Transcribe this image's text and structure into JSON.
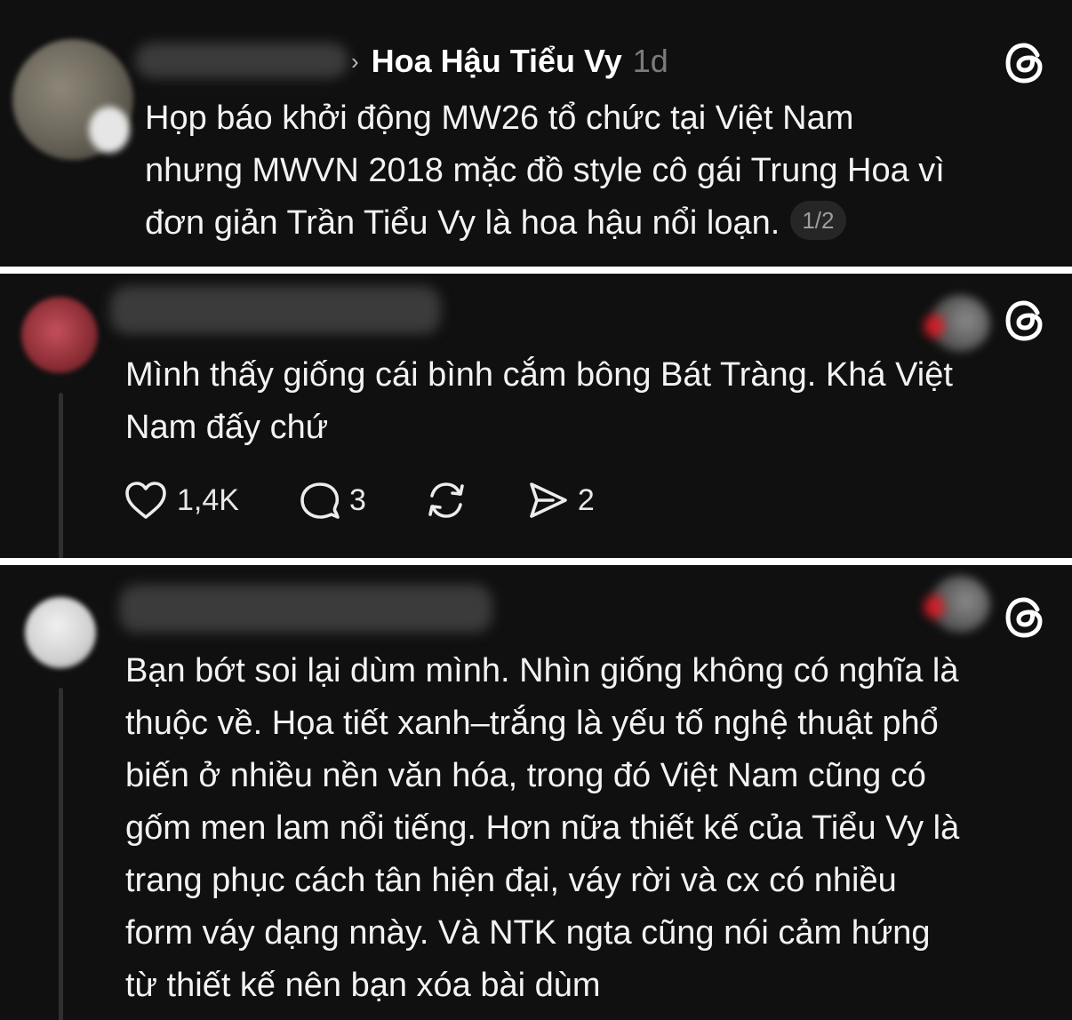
{
  "post": {
    "author": "Hoa Hậu Tiểu Vy",
    "time": "1d",
    "lines": [
      "Họp báo khởi động MW26 tổ chức tại Việt Nam",
      "nhưng MWVN 2018 mặc đồ style cô gái Trung Hoa vì",
      "đơn giản Trần Tiểu Vy là hoa hậu nổi loạn."
    ],
    "page_badge": "1/2"
  },
  "reply_1": {
    "lines": [
      "Mình thấy giống cái bình cắm bông Bát Tràng. Khá Việt",
      "Nam đấy chứ"
    ],
    "likes": "1,4K",
    "comments": "3",
    "shares": "2"
  },
  "reply_2": {
    "lines": [
      "Bạn bớt soi lại dùm mình. Nhìn giống không có nghĩa là",
      "thuộc về. Họa tiết xanh–trắng là yếu tố nghệ thuật phổ",
      "biến ở nhiều nền văn hóa, trong đó Việt Nam cũng có",
      "gốm men lam nổi tiếng. Hơn nữa thiết kế của Tiểu Vy là",
      "trang phục cách tân hiện đại, váy rời và cx có nhiều",
      "form váy dạng nnày. Và NTK ngta cũng nói cảm hứng",
      "từ thiết kế nên bạn xóa bài dùm"
    ]
  },
  "colors": {
    "background": "#101010",
    "separator": "#ffffff",
    "text": "#f3f3f3",
    "muted": "#7b7b7b",
    "blur_red": "#d41e28"
  },
  "icons": [
    "threads-logo-icon",
    "heart-icon",
    "comment-icon",
    "repost-icon",
    "share-icon",
    "chevron-right-icon"
  ]
}
